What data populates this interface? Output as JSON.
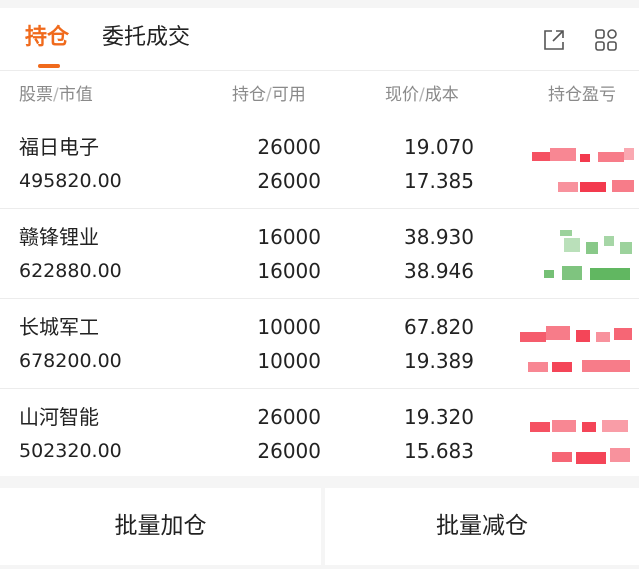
{
  "tabs": [
    {
      "label": "持仓",
      "active": true
    },
    {
      "label": "委托成交",
      "active": false
    }
  ],
  "header_icons": [
    "external-link-icon",
    "grid-icon"
  ],
  "columns": {
    "stock": "股票",
    "market_value": "市值",
    "position": "持仓",
    "available": "可用",
    "price": "现价",
    "cost": "成本",
    "pnl": "持仓盈亏",
    "separator": "/"
  },
  "holdings": [
    {
      "name": "福日电子",
      "market_value": "495820.00",
      "position": "26000",
      "available": "26000",
      "price": "19.070",
      "cost": "17.385",
      "pnl_color": "red"
    },
    {
      "name": "赣锋锂业",
      "market_value": "622880.00",
      "position": "16000",
      "available": "16000",
      "price": "38.930",
      "cost": "38.946",
      "pnl_color": "green"
    },
    {
      "name": "长城军工",
      "market_value": "678200.00",
      "position": "10000",
      "available": "10000",
      "price": "67.820",
      "cost": "19.389",
      "pnl_color": "red"
    },
    {
      "name": "山河智能",
      "market_value": "502320.00",
      "position": "26000",
      "available": "26000",
      "price": "19.320",
      "cost": "15.683",
      "pnl_color": "red"
    }
  ],
  "buttons": {
    "batch_add": "批量加仓",
    "batch_reduce": "批量减仓"
  },
  "colors": {
    "accent": "#f06a1c",
    "profit": "#f2253b",
    "loss": "#3aa53a"
  }
}
